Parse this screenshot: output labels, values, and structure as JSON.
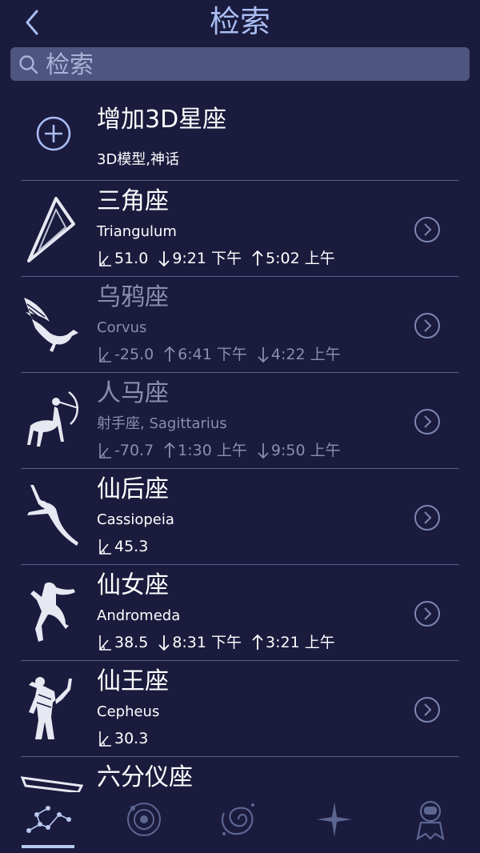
{
  "header": {
    "title": "检索"
  },
  "search": {
    "placeholder": "检索",
    "value": ""
  },
  "add": {
    "title": "增加3D星座",
    "subtitle": "3D模型,神话"
  },
  "constellations": [
    {
      "name": "三角座",
      "latin": "Triangulum",
      "altitude": "51.0",
      "first_time": "9:21 下午",
      "second_time": "5:02 上午",
      "first_arrow": "down",
      "second_arrow": "up",
      "dim": false
    },
    {
      "name": "乌鸦座",
      "latin": "Corvus",
      "altitude": "-25.0",
      "first_time": "6:41 下午",
      "second_time": "4:22 上午",
      "first_arrow": "up",
      "second_arrow": "down",
      "dim": true
    },
    {
      "name": "人马座",
      "latin": "射手座, Sagittarius",
      "altitude": "-70.7",
      "first_time": "1:30 上午",
      "second_time": "9:50 上午",
      "first_arrow": "up",
      "second_arrow": "down",
      "dim": true
    },
    {
      "name": "仙后座",
      "latin": "Cassiopeia",
      "altitude": "45.3",
      "dim": false
    },
    {
      "name": "仙女座",
      "latin": "Andromeda",
      "altitude": "38.5",
      "first_time": "8:31 下午",
      "second_time": "3:21 上午",
      "first_arrow": "down",
      "second_arrow": "up",
      "dim": false
    },
    {
      "name": "仙王座",
      "latin": "Cepheus",
      "altitude": "30.3",
      "dim": false
    },
    {
      "name": "六分仪座",
      "dim": false
    }
  ],
  "tabs": [
    "constellations-icon",
    "solar-system-icon",
    "galaxy-icon",
    "star-icon",
    "astronaut-icon"
  ],
  "colors": {
    "background": "#1a1b3d",
    "accent": "#a9bdf2",
    "search_bg": "#4d5580",
    "dim_text": "#8a8fad"
  }
}
